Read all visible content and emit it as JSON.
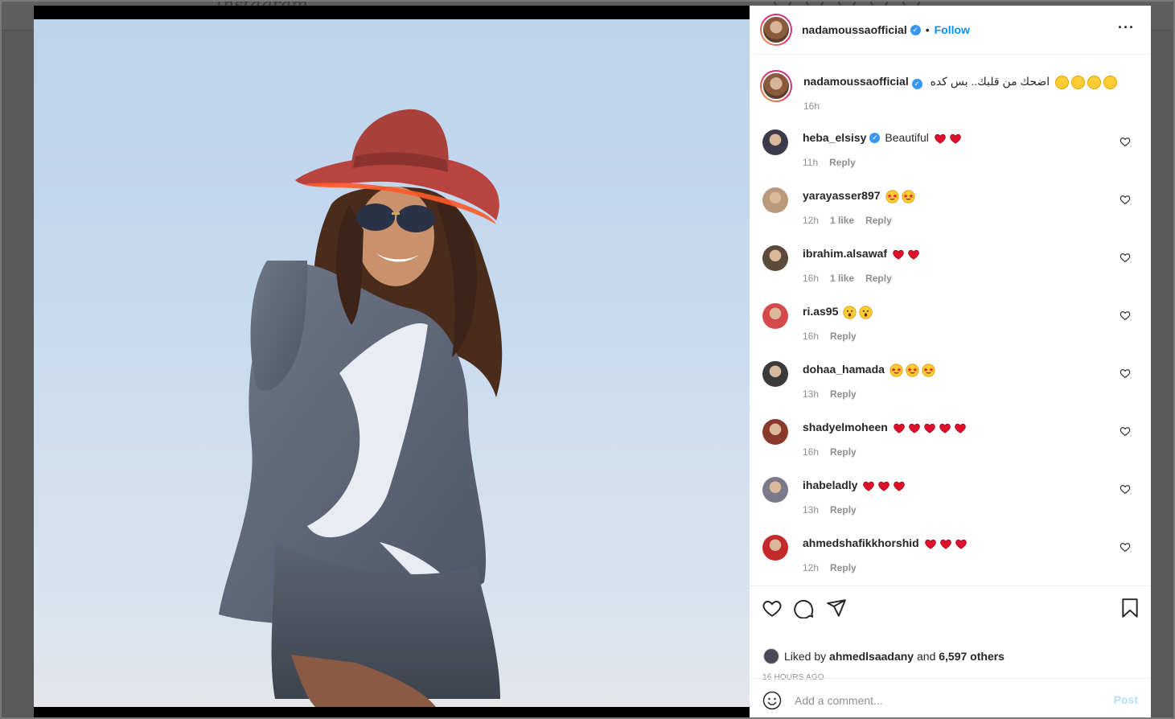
{
  "background": {
    "logo": "Instagram"
  },
  "post": {
    "username": "nadamoussaofficial",
    "separator": "•",
    "follow_label": "Follow",
    "more_icon": "more-horizontal-icon",
    "caption": {
      "username": "nadamoussaofficial",
      "text": "اضحك من قلبك.. بس كده",
      "time": "16h"
    },
    "comments": [
      {
        "username": "heba_elsisy",
        "verified": true,
        "text": "Beautiful",
        "emoji": [
          "heart",
          "heart"
        ],
        "time": "11h",
        "likes": "",
        "reply": "Reply",
        "avatar_color": "#3a3a4a"
      },
      {
        "username": "yarayasser897",
        "verified": false,
        "text": "",
        "emoji": [
          "star-eyes",
          "star-eyes"
        ],
        "time": "12h",
        "likes": "1 like",
        "reply": "Reply",
        "avatar_color": "#b89a7a"
      },
      {
        "username": "ibrahim.alsawaf",
        "verified": false,
        "text": "",
        "emoji": [
          "heart",
          "heart"
        ],
        "time": "16h",
        "likes": "1 like",
        "reply": "Reply",
        "avatar_color": "#5a4a3a"
      },
      {
        "username": "ri.as95",
        "verified": false,
        "text": "",
        "emoji": [
          "wow",
          "wow"
        ],
        "time": "16h",
        "likes": "",
        "reply": "Reply",
        "avatar_color": "#d44a4a"
      },
      {
        "username": "dohaa_hamada",
        "verified": false,
        "text": "",
        "emoji": [
          "star-eyes",
          "star-eyes",
          "star-eyes"
        ],
        "time": "13h",
        "likes": "",
        "reply": "Reply",
        "avatar_color": "#3a3a3a"
      },
      {
        "username": "shadyelmoheen",
        "verified": false,
        "text": "",
        "emoji": [
          "heart",
          "heart",
          "heart",
          "heart",
          "heart"
        ],
        "time": "16h",
        "likes": "",
        "reply": "Reply",
        "avatar_color": "#8a3a2a"
      },
      {
        "username": "ihabeladly",
        "verified": false,
        "text": "",
        "emoji": [
          "heart",
          "heart",
          "heart"
        ],
        "time": "13h",
        "likes": "",
        "reply": "Reply",
        "avatar_color": "#7a7a8a"
      },
      {
        "username": "ahmedshafikkhorshid",
        "verified": false,
        "text": "",
        "emoji": [
          "heart",
          "heart",
          "heart"
        ],
        "time": "12h",
        "likes": "",
        "reply": "Reply",
        "avatar_color": "#c42a2a"
      }
    ],
    "liked_by": {
      "prefix": "Liked by",
      "user": "ahmedlsaadany",
      "and": "and",
      "others": "6,597 others"
    },
    "posted_ago": "16 HOURS AGO",
    "comment_placeholder": "Add a comment...",
    "post_label": "Post"
  }
}
